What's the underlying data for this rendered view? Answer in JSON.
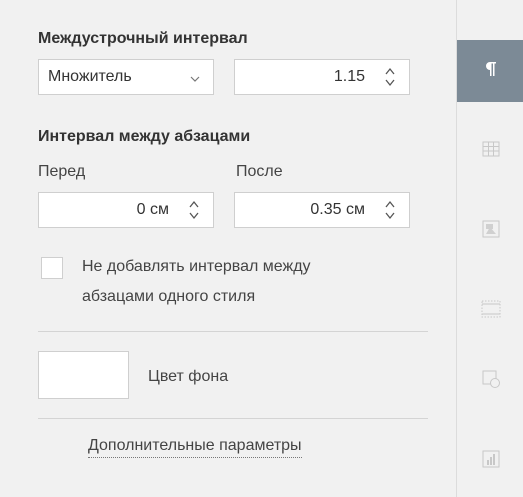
{
  "line_spacing": {
    "heading": "Междустрочный интервал",
    "mode_select": {
      "selected": "Множитель"
    },
    "value": "1.15"
  },
  "paragraph_spacing": {
    "heading": "Интервал между абзацами",
    "before_label": "Перед",
    "after_label": "После",
    "before_value": "0 см",
    "after_value": "0.35 см"
  },
  "no_spacing_checkbox": {
    "checked": false,
    "label_line1": "Не добавлять интервал между",
    "label_line2": "абзацами одного стиля"
  },
  "background_color": {
    "label": "Цвет фона",
    "value": "#ffffff"
  },
  "advanced_link": "Дополнительные параметры",
  "sidebar_tabs": [
    {
      "icon": "paragraph-icon",
      "active": true
    },
    {
      "icon": "table-icon",
      "active": false
    },
    {
      "icon": "image-icon",
      "active": false
    },
    {
      "icon": "header-footer-icon",
      "active": false
    },
    {
      "icon": "shape-icon",
      "active": false
    },
    {
      "icon": "chart-icon",
      "active": false
    }
  ]
}
